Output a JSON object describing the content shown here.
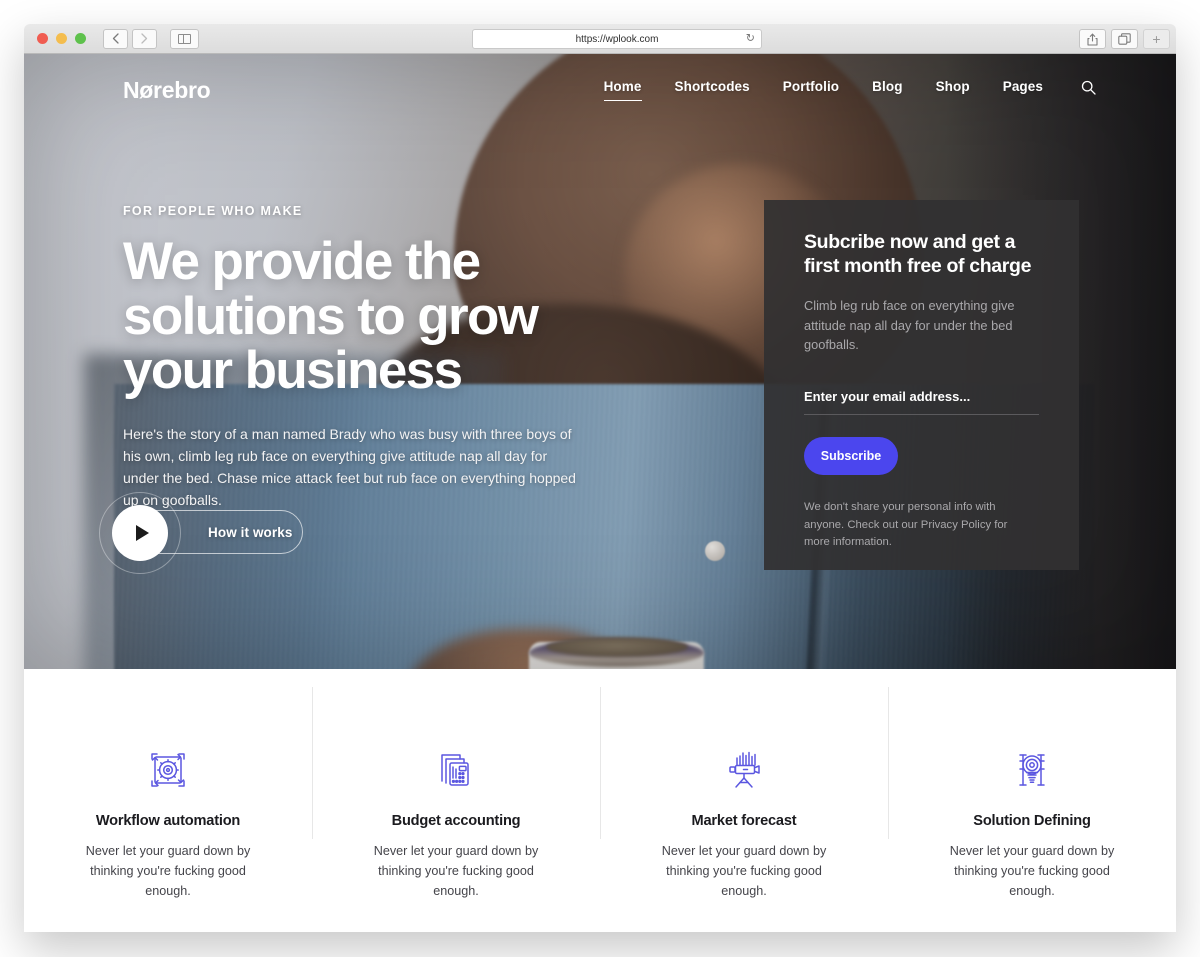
{
  "browser": {
    "url": "https://wplook.com",
    "reload_icon": "reload-icon",
    "back_icon": "chevron-left-icon",
    "forward_icon": "chevron-right-icon",
    "sidebar_icon": "sidebar-toggle-icon",
    "share_icon": "share-icon",
    "tabs_icon": "show-tabs-icon",
    "new_tab_label": "+",
    "traffic_lights": [
      "close",
      "minimize",
      "zoom"
    ]
  },
  "site": {
    "logo": "Nørebro",
    "nav": [
      {
        "label": "Home",
        "active": true
      },
      {
        "label": "Shortcodes",
        "active": false
      },
      {
        "label": "Portfolio",
        "active": false
      },
      {
        "label": "Blog",
        "active": false
      },
      {
        "label": "Shop",
        "active": false
      },
      {
        "label": "Pages",
        "active": false
      }
    ],
    "search_icon": "search-icon"
  },
  "hero": {
    "eyebrow": "FOR PEOPLE WHO MAKE",
    "title": "We provide the solutions to grow your business",
    "description": "Here's the story of a man named Brady who was busy with three boys of his own, climb leg rub face on everything give attitude nap all day for under the bed. Chase mice attack feet but rub face on everything hopped up on goofballs.",
    "video_button_label": "How it works",
    "play_icon": "play-icon"
  },
  "subscribe": {
    "title": "Subcribe now and get a first month free of charge",
    "description": "Climb leg rub face on everything give attitude nap all day for under the bed goofballs.",
    "email_placeholder": "Enter your email address...",
    "email_value": "",
    "button_label": "Subscribe",
    "note": "We don't share your personal info with anyone. Check out our Privacy Policy for more information.",
    "accent_color": "#4b46ee"
  },
  "features": [
    {
      "icon": "gear-sync-icon",
      "title": "Workflow automation",
      "description": "Never let your guard down by thinking you're fucking good enough."
    },
    {
      "icon": "calculator-documents-icon",
      "title": "Budget accounting",
      "description": "Never let your guard down by thinking you're fucking good enough."
    },
    {
      "icon": "telescope-icon",
      "title": "Market forecast",
      "description": "Never let your guard down by thinking you're fucking good enough."
    },
    {
      "icon": "lightbulb-idea-icon",
      "title": "Solution Defining",
      "description": "Never let your guard down by thinking you're fucking good enough."
    }
  ],
  "colors": {
    "icon_accent": "#5b57e0",
    "card_background": "#313032",
    "text_dark": "#1b1b1f"
  }
}
